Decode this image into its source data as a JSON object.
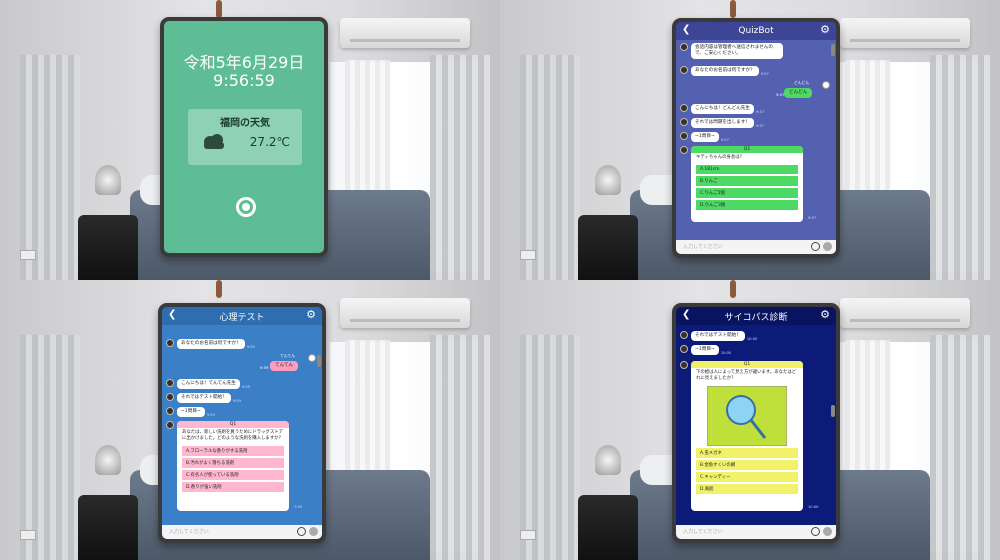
{
  "clock": {
    "date": "令和5年6月29日",
    "time": "9:56:59",
    "weather_title": "福岡の天気",
    "temperature": "27.2℃",
    "weather_icon": "cloud-icon",
    "bg_color": "#5ebd95"
  },
  "quizbot": {
    "title": "QuizBot",
    "bg_color": "#5460b0",
    "header_color": "#3d4696",
    "messages": [
      {
        "text": "会話内容は管理者へ送信されませんので、ご安心ください。",
        "time": ""
      },
      {
        "text": "あなたのお名前は何ですか？",
        "time": "9:57"
      }
    ],
    "user_name": "どんどん",
    "user_reply": "どんどん",
    "user_time": "9:57",
    "messages2": [
      {
        "text": "こんにちは！どんどん先生",
        "time": "9:57"
      },
      {
        "text": "それでは問題を出します！",
        "time": "9:57"
      },
      {
        "text": "~1問目~",
        "time": "9:57"
      }
    ],
    "question": {
      "header": "Q1",
      "text": "キティちゃんの身長は？",
      "options": [
        "A.181cm",
        "B.りんご",
        "C.りんご5個",
        "D.りんご3個"
      ],
      "time": "9:57"
    },
    "input_placeholder": "入力してください"
  },
  "psych": {
    "title": "心理テスト",
    "bg_color": "#3b80c6",
    "header_color": "#2e6db0",
    "messages": [
      {
        "text": "あなたのお名前は何ですか？",
        "time": "9:59"
      }
    ],
    "user_name": "てんてん",
    "user_reply": "てんてん",
    "user_time": "9:59",
    "messages2": [
      {
        "text": "こんにちは！てんてん先生",
        "time": "9:59"
      },
      {
        "text": "それではテスト開始！",
        "time": "9:59"
      },
      {
        "text": "~1問目~",
        "time": "9:59"
      }
    ],
    "question": {
      "header": "Q1",
      "text": "あなたは、新しい洗剤を買うためにドラッグストアに出かけました。どのような洗剤を購入しますか？",
      "options": [
        "A.フローラルな香りがする洗剤",
        "B.汚れがよく落ちる洗剤",
        "C.有名人が使っている洗剤",
        "D.香りが強い洗剤"
      ],
      "time": "7:59"
    },
    "input_placeholder": "入力してください"
  },
  "psycho": {
    "title": "サイコパス診断",
    "bg_color": "#0c1a78",
    "header_color": "#091461",
    "messages": [
      {
        "text": "それではテスト開始！",
        "time": "10:00"
      },
      {
        "text": "~1問目~",
        "time": "10:00"
      }
    ],
    "question": {
      "header": "Q1",
      "text": "下の絵は人によって見え方が違います。あなたはどれに見えましたか？",
      "image_icon": "magnifier-icon",
      "options": [
        "A.虫メガネ",
        "B.金魚すくいの網",
        "C.キャンディー",
        "D.風船"
      ],
      "time": "10:00"
    },
    "input_placeholder": "入力してください"
  }
}
